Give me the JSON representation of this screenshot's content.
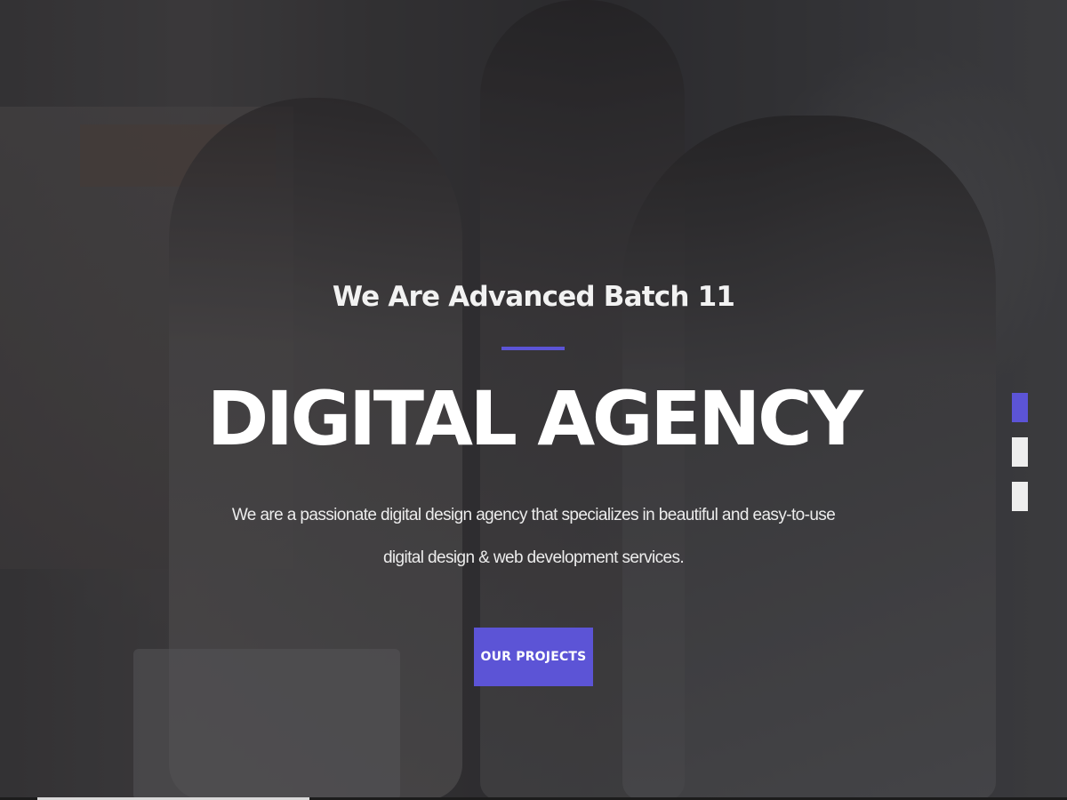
{
  "hero": {
    "subtitle": "We Are Advanced Batch 11",
    "headline": "DIGITAL AGENCY",
    "description": "We are a passionate digital design agency that specializes in beautiful and easy-to-use digital design & web development services.",
    "cta_label": "OUR PROJECTS"
  },
  "slider": {
    "total": 3,
    "active": 1
  },
  "colors": {
    "accent": "#5c54d6",
    "overlay": "#1e1e22",
    "text": "#ffffff"
  }
}
